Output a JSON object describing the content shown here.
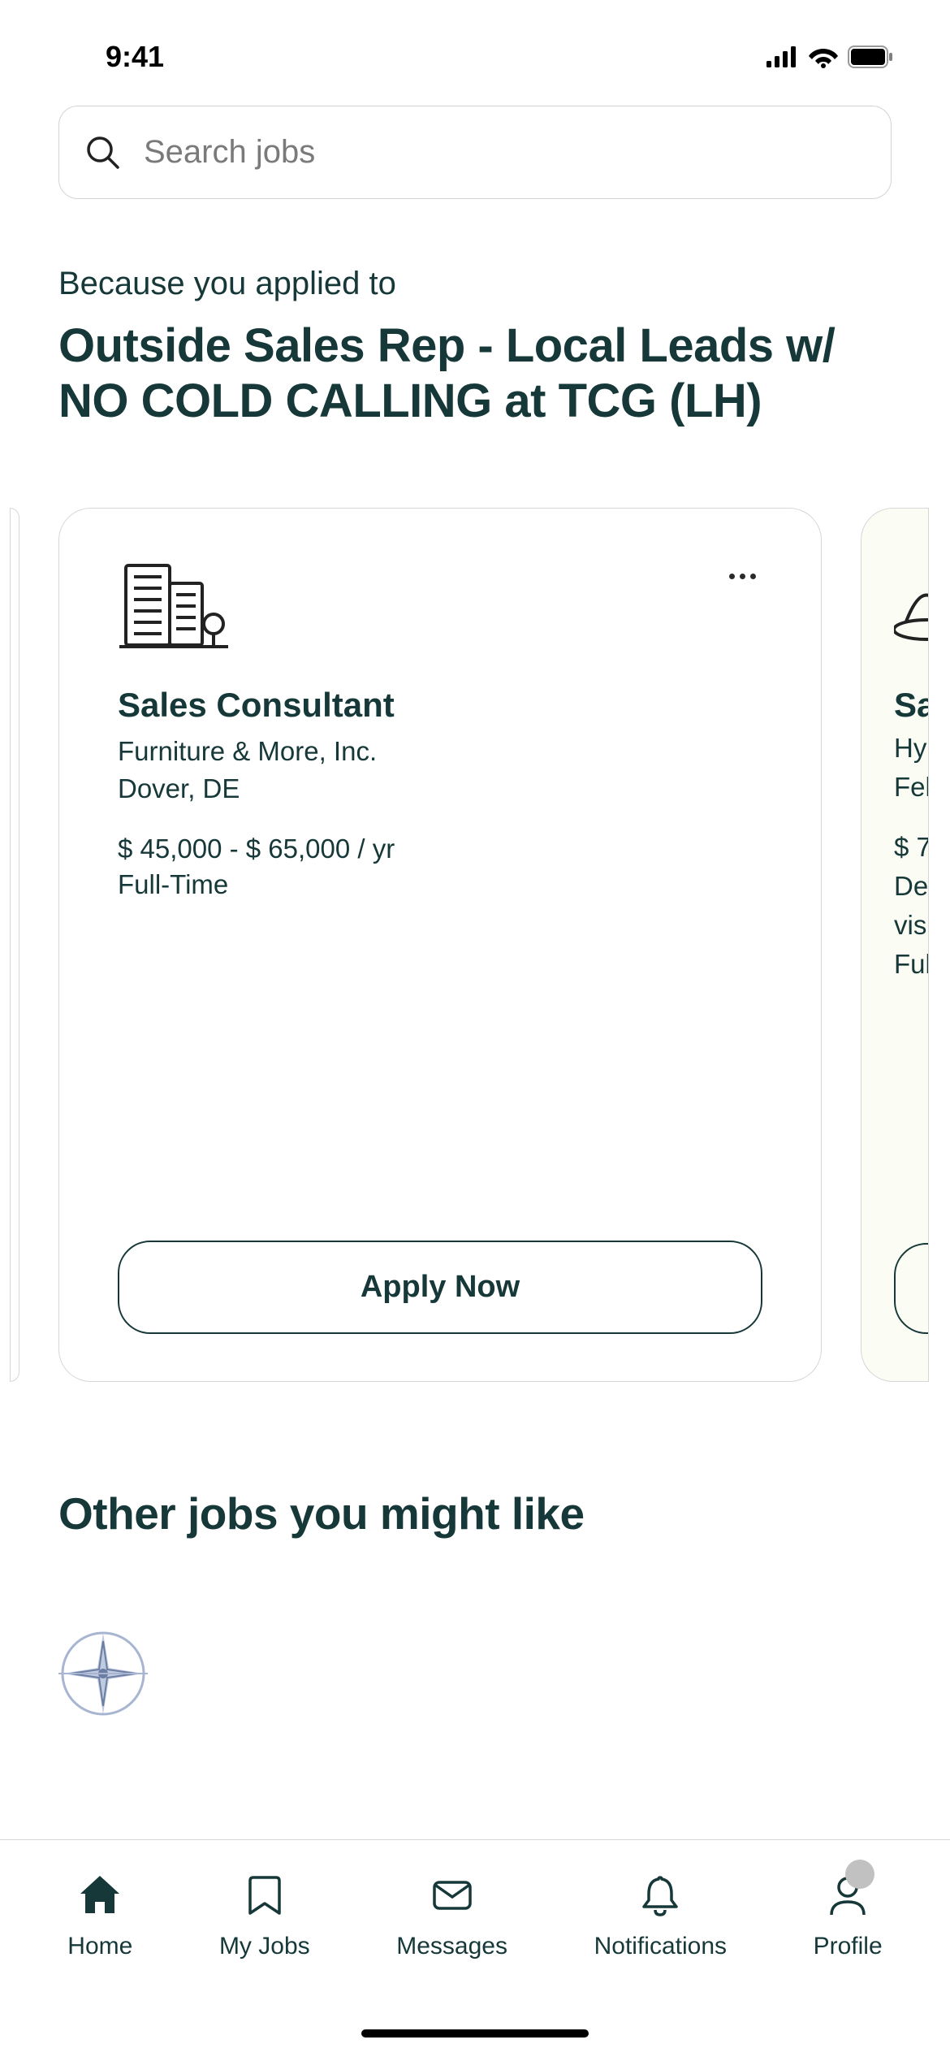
{
  "status_bar": {
    "time": "9:41"
  },
  "search": {
    "placeholder": "Search jobs"
  },
  "reason": {
    "label": "Because you applied to",
    "title": "Outside Sales Rep - Local Leads w/ NO COLD CALLING at TCG (LH)"
  },
  "job_card": {
    "title": "Sales Consultant",
    "company": "Furniture & More, Inc.",
    "location": "Dover, DE",
    "salary": "$ 45,000 - $ 65,000 / yr",
    "type": "Full-Time",
    "apply_label": "Apply Now"
  },
  "peek_card": {
    "title": "Sa",
    "line1": "Hy",
    "line2": "Fel",
    "salary": "$ 7",
    "line3": "De",
    "line4": "vis",
    "line5": "Ful"
  },
  "other_section": {
    "title": "Other jobs you might like"
  },
  "tabs": {
    "home": "Home",
    "my_jobs": "My Jobs",
    "messages": "Messages",
    "notifications": "Notifications",
    "profile": "Profile"
  }
}
